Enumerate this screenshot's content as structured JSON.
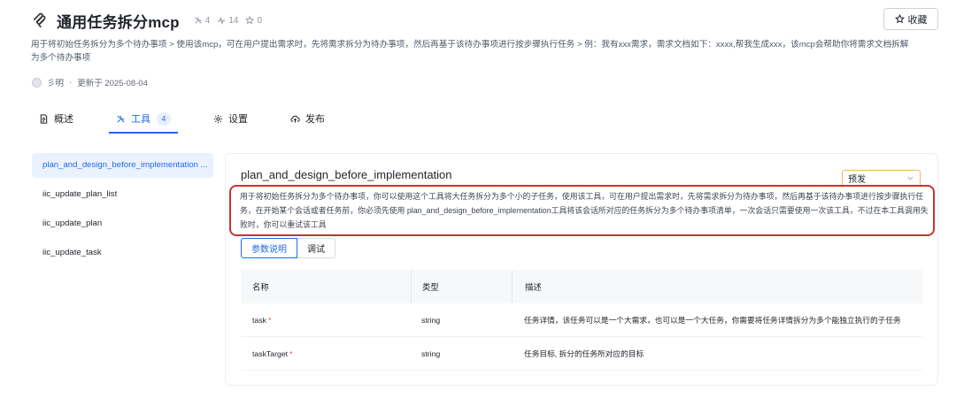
{
  "header": {
    "title": "通用任务拆分mcp",
    "stats": {
      "tools": "4",
      "calls": "14",
      "stars": "0"
    },
    "collect_label": "收藏"
  },
  "description": "用于将初始任务拆分为多个待办事项 > 使用该mcp，可在用户提出需求时，先将需求拆分为待办事项，然后再基于该待办事项进行按步骤执行任务 > 例：我有xxx需求，需求文档如下：xxxx,帮我生成xxx，该mcp会帮助你将需求文档拆解为多个待办事项",
  "meta": {
    "author": "彡明",
    "separator": "·",
    "updated": "更新于 2025-08-04"
  },
  "tabs": [
    {
      "label": "概述",
      "icon": "document-icon"
    },
    {
      "label": "工具",
      "icon": "tools-icon",
      "count": "4",
      "active": true
    },
    {
      "label": "设置",
      "icon": "gear-icon"
    },
    {
      "label": "发布",
      "icon": "cloud-upload-icon"
    }
  ],
  "sidebar": {
    "items": [
      {
        "label": "plan_and_design_before_implementation ...",
        "active": true
      },
      {
        "label": "iic_update_plan_list"
      },
      {
        "label": "iic_update_plan"
      },
      {
        "label": "iic_update_task"
      }
    ]
  },
  "tool": {
    "name": "plan_and_design_before_implementation",
    "version": "预发",
    "description": "用于将初始任务拆分为多个待办事项，你可以使用这个工具将大任务拆分为多个小的子任务，使用该工具，可在用户提出需求时，先将需求拆分为待办事项，然后再基于该待办事项进行按步骤执行任务，在开始某个会话或者任务前，你必须先使用 plan_and_design_before_implementation工具将该会话所对应的任务拆分为多个待办事项清单，一次会话只需要使用一次该工具，不过在本工具调用失败时，你可以重试该工具",
    "sub_tabs": [
      "参数说明",
      "调试"
    ],
    "table": {
      "headers": [
        "名称",
        "类型",
        "描述"
      ],
      "rows": [
        {
          "name": "task",
          "required": "*",
          "type": "string",
          "desc": "任务详情，该任务可以是一个大需求，也可以是一个大任务，你需要将任务详情拆分为多个能独立执行的子任务"
        },
        {
          "name": "taskTarget",
          "required": "*",
          "type": "string",
          "desc": "任务目标, 拆分的任务所对应的目标"
        }
      ]
    }
  },
  "colors": {
    "accent": "#1f6be6",
    "highlight_border": "#c8332f",
    "required": "#e24b3b"
  }
}
